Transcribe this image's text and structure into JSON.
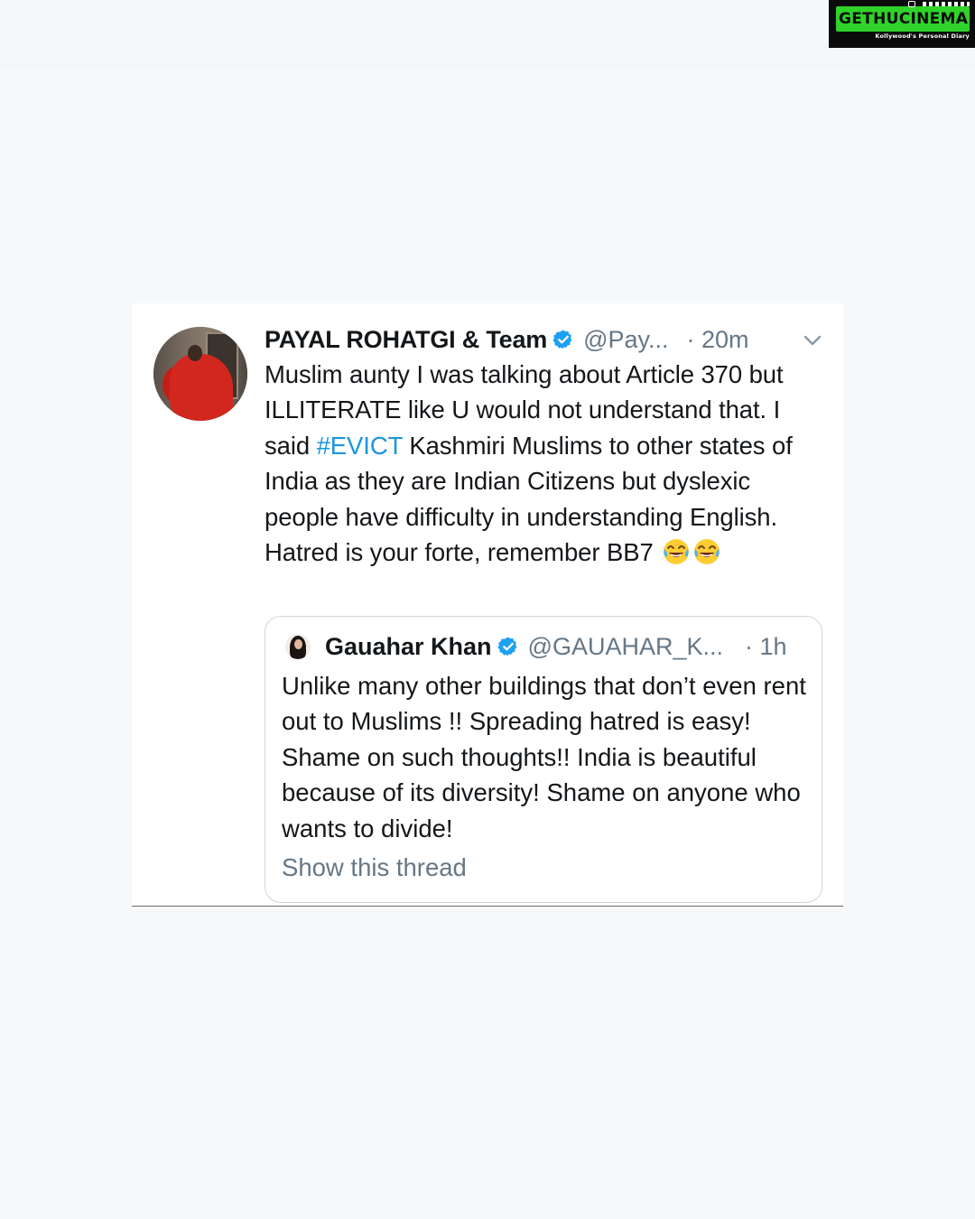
{
  "watermark": {
    "brand_part1": "GETHU",
    "brand_part2": "CINEMA",
    "tagline": "Kollywood's Personal Diary"
  },
  "tweet": {
    "author_name": "PAYAL ROHATGI & Team",
    "handle": "@Pay...",
    "time": "· 20m",
    "text_before": "Muslim aunty I was talking about Article 370 but ILLITERATE like U would not understand that. I said ",
    "hashtag": "#EVICT",
    "text_after": " Kashmiri Muslims to other states of India as they are Indian Citizens but dyslexic people have difficulty in understanding English. Hatred is your forte, remember BB7",
    "emojis": [
      "face-with-tears-of-joy-icon",
      "face-with-tears-of-joy-icon"
    ],
    "colors": {
      "hashtag": "#1b95e0",
      "verified": "#1da1f2",
      "secondary_text": "#657786"
    }
  },
  "quoted_tweet": {
    "author_name": "Gauahar Khan",
    "handle": "@GAUAHAR_K...",
    "time": "· 1h",
    "text": "Unlike many other buildings that don’t even rent out to Muslims !! Spreading hatred is easy! Shame on such thoughts!! India is beautiful because of its diversity! Shame on anyone who wants to divide!",
    "show_thread": "Show this thread"
  }
}
